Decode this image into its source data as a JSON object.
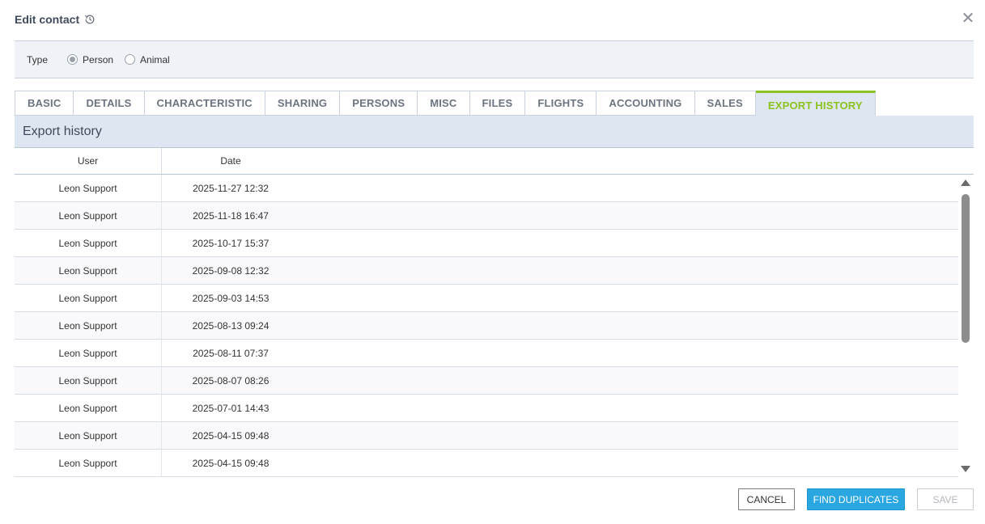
{
  "header": {
    "title": "Edit contact",
    "history_icon": "history-icon",
    "close_icon": "close-icon",
    "close_glyph": "✕"
  },
  "type_bar": {
    "label": "Type",
    "options": [
      {
        "label": "Person",
        "selected": true
      },
      {
        "label": "Animal",
        "selected": false
      }
    ]
  },
  "tabs": [
    {
      "label": "BASIC"
    },
    {
      "label": "DETAILS"
    },
    {
      "label": "CHARACTERISTIC"
    },
    {
      "label": "SHARING"
    },
    {
      "label": "PERSONS"
    },
    {
      "label": "MISC"
    },
    {
      "label": "FILES"
    },
    {
      "label": "FLIGHTS"
    },
    {
      "label": "ACCOUNTING"
    },
    {
      "label": "SALES"
    },
    {
      "label": "EXPORT HISTORY",
      "active": true
    }
  ],
  "section": {
    "title": "Export history"
  },
  "table": {
    "columns": [
      "User",
      "Date"
    ],
    "rows": [
      {
        "user": "Leon Support",
        "date": "2025-11-27 12:32"
      },
      {
        "user": "Leon Support",
        "date": "2025-11-18 16:47"
      },
      {
        "user": "Leon Support",
        "date": "2025-10-17 15:37"
      },
      {
        "user": "Leon Support",
        "date": "2025-09-08 12:32"
      },
      {
        "user": "Leon Support",
        "date": "2025-09-03 14:53"
      },
      {
        "user": "Leon Support",
        "date": "2025-08-13 09:24"
      },
      {
        "user": "Leon Support",
        "date": "2025-08-11 07:37"
      },
      {
        "user": "Leon Support",
        "date": "2025-08-07 08:26"
      },
      {
        "user": "Leon Support",
        "date": "2025-07-01 14:43"
      },
      {
        "user": "Leon Support",
        "date": "2025-04-15 09:48"
      },
      {
        "user": "Leon Support",
        "date": "2025-04-15 09:48"
      }
    ]
  },
  "footer": {
    "cancel_label": "CANCEL",
    "find_duplicates_label": "FIND DUPLICATES",
    "save_label": "SAVE"
  },
  "colors": {
    "accent_green": "#8cc21f",
    "primary_blue": "#2aa6e0",
    "tab_bg_active": "#dde6f1",
    "type_bar_bg": "#eff2f7"
  }
}
